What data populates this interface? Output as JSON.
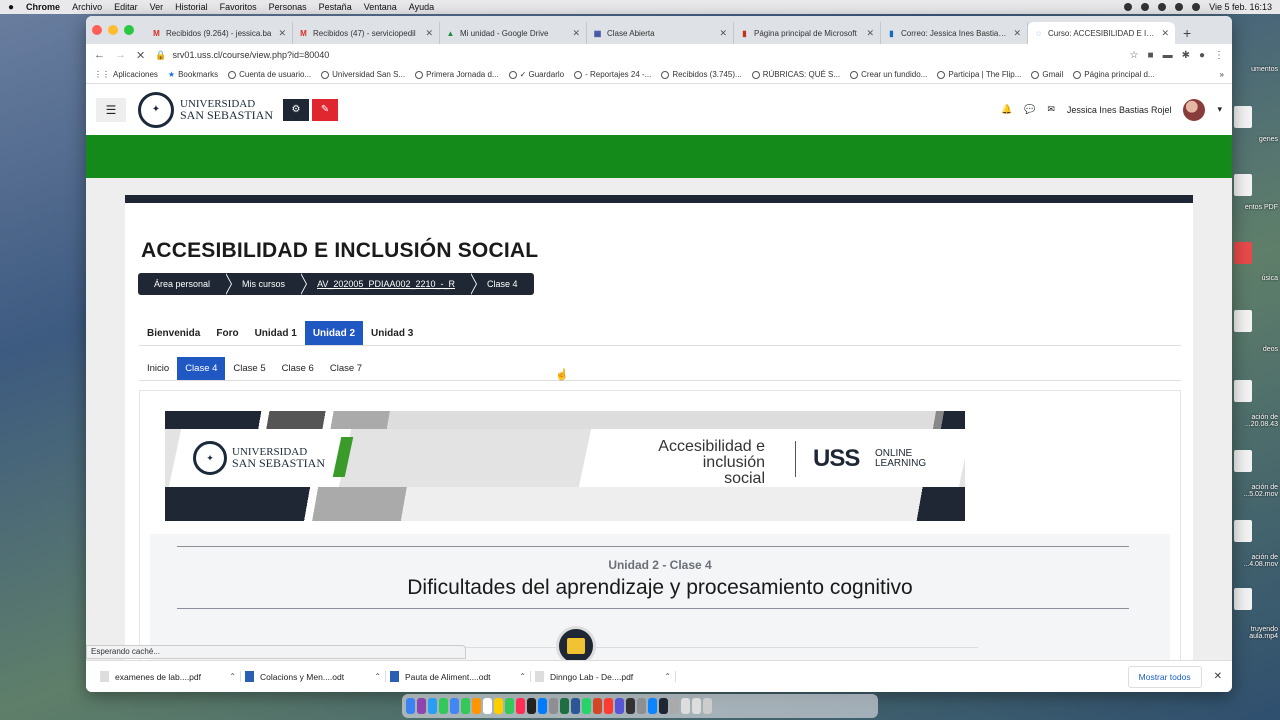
{
  "menubar": {
    "apple": "",
    "app": "Chrome",
    "items": [
      "Archivo",
      "Editar",
      "Ver",
      "Historial",
      "Favoritos",
      "Personas",
      "Pestaña",
      "Ventana",
      "Ayuda"
    ],
    "clock": "Vie 5 feb.  16:13"
  },
  "browser": {
    "tabs": [
      {
        "label": "Recibidos (9.264) - jessica.ba",
        "icon": "M",
        "color": "#d93025"
      },
      {
        "label": "Recibidos (47) - serviciopedil",
        "icon": "M",
        "color": "#d93025"
      },
      {
        "label": "Mi unidad - Google Drive",
        "icon": "▲",
        "color": "#1e8e3e"
      },
      {
        "label": "Clase Abierta",
        "icon": "▦",
        "color": "#3c4ba0"
      },
      {
        "label": "Página principal de Microsoft",
        "icon": "▮",
        "color": "#c4321a"
      },
      {
        "label": "Correo: Jessica Ines Bastias R",
        "icon": "▮",
        "color": "#0f6cbd"
      },
      {
        "label": "Curso: ACCESIBILIDAD E INCL",
        "icon": "◌",
        "color": "#1a73e8"
      }
    ],
    "url": "srv01.uss.cl/course/view.php?id=80040",
    "bookmarks": [
      "Aplicaciones",
      "Bookmarks",
      "Cuenta de usuario...",
      "Universidad San S...",
      "Primera Jornada d...",
      "✓ Guardarlo",
      "- Reportajes 24 -...",
      "Recibidos (3.745)...",
      "RÚBRICAS: QUÉ S...",
      "Crear un fundido...",
      "Participa | The Flip...",
      "Gmail",
      "Página principal d..."
    ]
  },
  "site": {
    "logo_line1": "UNIVERSIDAD",
    "logo_line2": "SAN SEBASTIAN",
    "user_name": "Jessica Ines Bastias Rojel",
    "accent_blue": "#1f57c3",
    "brand_green": "#138a1a",
    "dark": "#1e2733"
  },
  "course": {
    "title": "ACCESIBILIDAD E INCLUSIÓN SOCIAL",
    "breadcrumb": [
      "Área personal",
      "Mis cursos",
      "AV_202005_PDIAA002_2210_-_R",
      "Clase 4"
    ],
    "units": [
      "Bienvenida",
      "Foro",
      "Unidad 1",
      "Unidad 2",
      "Unidad 3"
    ],
    "active_unit": "Unidad 2",
    "classes": [
      "Inicio",
      "Clase 4",
      "Clase 5",
      "Clase 6",
      "Clase 7"
    ],
    "active_class": "Clase 4"
  },
  "banner": {
    "logo_line1": "UNIVERSIDAD",
    "logo_line2": "SAN SEBASTIAN",
    "title_line1": "Accesibilidad e inclusión",
    "title_line2": "social",
    "uss": "USS",
    "online1": "ONLINE",
    "online2": "LEARNING"
  },
  "lesson": {
    "unit": "Unidad 2 - Clase 4",
    "title": "Dificultades del aprendizaje y procesamiento cognitivo"
  },
  "status_text": "Esperando caché...",
  "downloads": {
    "items": [
      "examenes de lab....pdf",
      "Colacions y Men....odt",
      "Pauta de Aliment....odt",
      "Dinngo Lab - De....pdf"
    ],
    "show_all": "Mostrar todos"
  },
  "desktop": {
    "labels": [
      "umentos",
      "genes",
      "entos PDF",
      "úsica",
      "deos",
      "ación de\n...20.08.43",
      "ación de\n...5.02.mov",
      "ación de\n...4.08.mov",
      "ación de",
      "truyendo\naula.mp4"
    ]
  }
}
